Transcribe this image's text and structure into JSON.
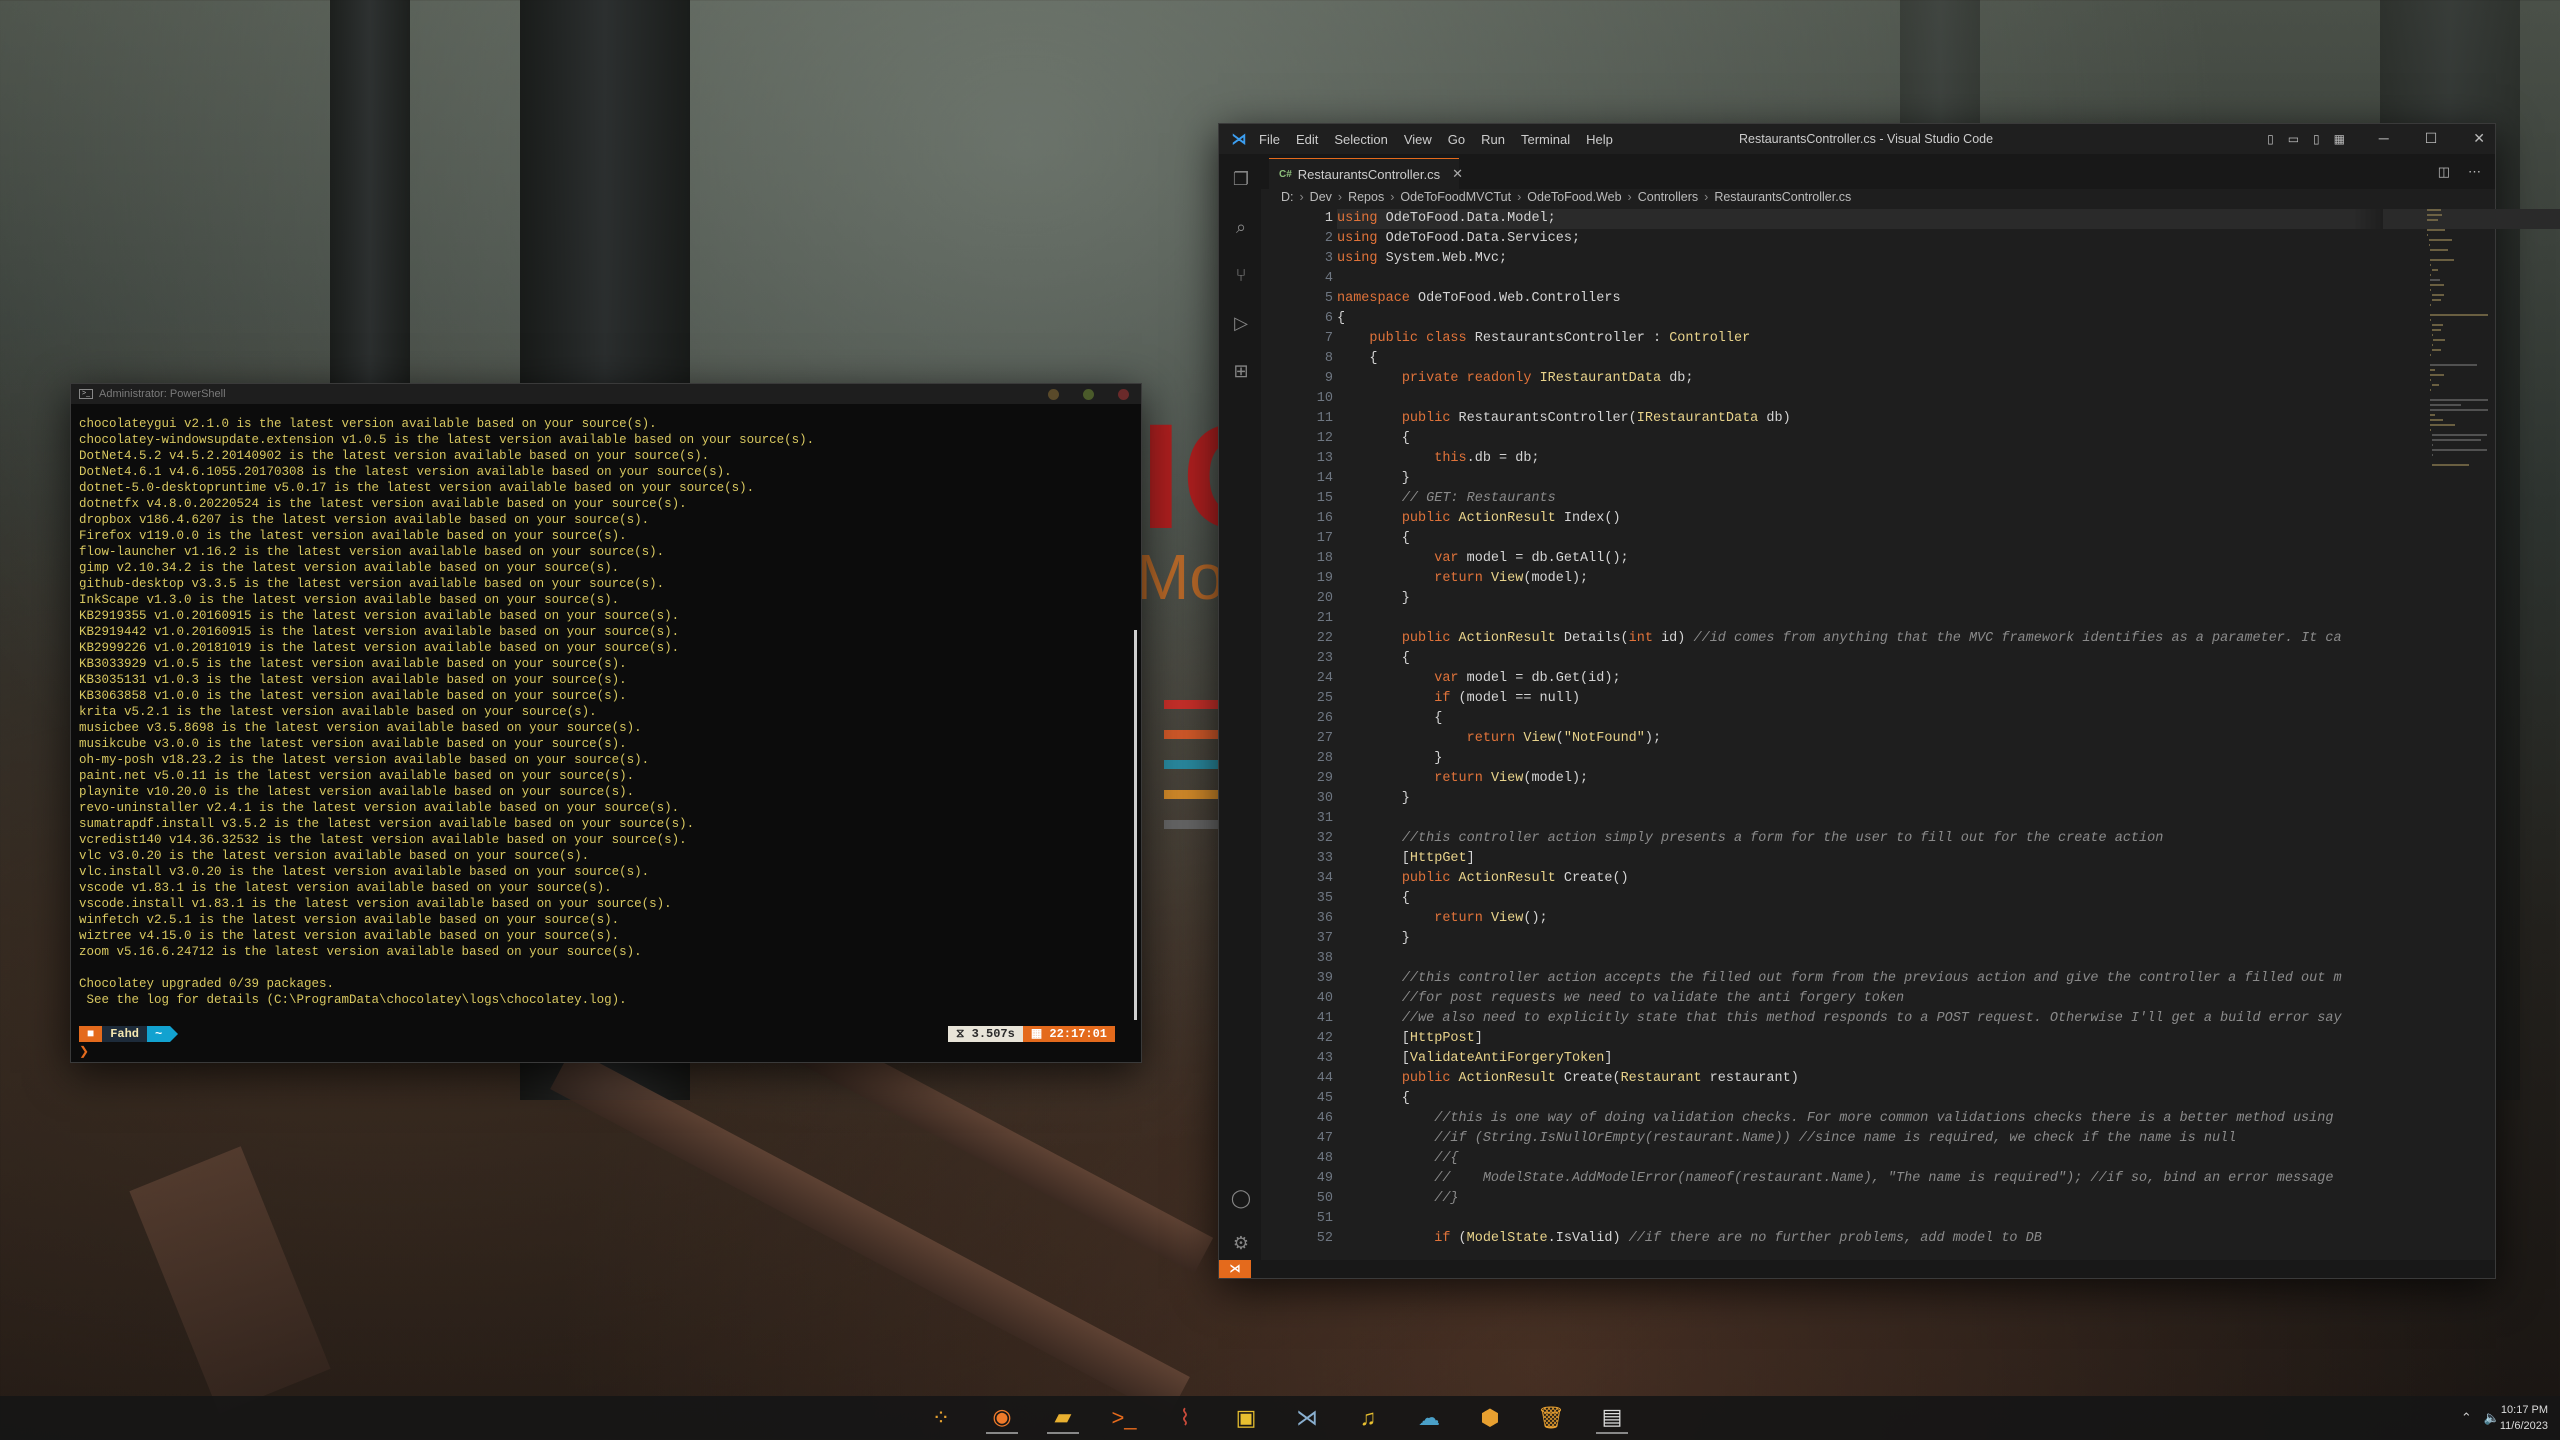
{
  "colors": {
    "accent": "#e46a1c",
    "vscode_blue": "#3c9ef0",
    "terminal_text": "#d8c860"
  },
  "wallpaper": {
    "poster_big": "IC",
    "poster_mon": "Mon"
  },
  "powershell": {
    "title": "Administrator: PowerShell",
    "lines": [
      "chocolateygui v2.1.0 is the latest version available based on your source(s).",
      "chocolatey-windowsupdate.extension v1.0.5 is the latest version available based on your source(s).",
      "DotNet4.5.2 v4.5.2.20140902 is the latest version available based on your source(s).",
      "DotNet4.6.1 v4.6.1055.20170308 is the latest version available based on your source(s).",
      "dotnet-5.0-desktopruntime v5.0.17 is the latest version available based on your source(s).",
      "dotnetfx v4.8.0.20220524 is the latest version available based on your source(s).",
      "dropbox v186.4.6207 is the latest version available based on your source(s).",
      "Firefox v119.0.0 is the latest version available based on your source(s).",
      "flow-launcher v1.16.2 is the latest version available based on your source(s).",
      "gimp v2.10.34.2 is the latest version available based on your source(s).",
      "github-desktop v3.3.5 is the latest version available based on your source(s).",
      "InkScape v1.3.0 is the latest version available based on your source(s).",
      "KB2919355 v1.0.20160915 is the latest version available based on your source(s).",
      "KB2919442 v1.0.20160915 is the latest version available based on your source(s).",
      "KB2999226 v1.0.20181019 is the latest version available based on your source(s).",
      "KB3033929 v1.0.5 is the latest version available based on your source(s).",
      "KB3035131 v1.0.3 is the latest version available based on your source(s).",
      "KB3063858 v1.0.0 is the latest version available based on your source(s).",
      "krita v5.2.1 is the latest version available based on your source(s).",
      "musicbee v3.5.8698 is the latest version available based on your source(s).",
      "musikcube v3.0.0 is the latest version available based on your source(s).",
      "oh-my-posh v18.23.2 is the latest version available based on your source(s).",
      "paint.net v5.0.11 is the latest version available based on your source(s).",
      "playnite v10.20.0 is the latest version available based on your source(s).",
      "revo-uninstaller v2.4.1 is the latest version available based on your source(s).",
      "sumatrapdf.install v3.5.2 is the latest version available based on your source(s).",
      "vcredist140 v14.36.32532 is the latest version available based on your source(s).",
      "vlc v3.0.20 is the latest version available based on your source(s).",
      "vlc.install v3.0.20 is the latest version available based on your source(s).",
      "vscode v1.83.1 is the latest version available based on your source(s).",
      "vscode.install v1.83.1 is the latest version available based on your source(s).",
      "winfetch v2.5.1 is the latest version available based on your source(s).",
      "wiztree v4.15.0 is the latest version available based on your source(s).",
      "zoom v5.16.6.24712 is the latest version available based on your source(s).",
      "",
      "Chocolatey upgraded 0/39 packages.",
      " See the log for details (C:\\ProgramData\\chocolatey\\logs\\chocolatey.log)."
    ],
    "prompt_user": "Fahd",
    "prompt_dir": "~",
    "prompt_duration": "3.507s",
    "prompt_time": "22:17:01",
    "prompt_cursor": "❯"
  },
  "vscode": {
    "window_title": "RestaurantsController.cs - Visual Studio Code",
    "menu": [
      "File",
      "Edit",
      "Selection",
      "View",
      "Go",
      "Run",
      "Terminal",
      "Help"
    ],
    "tab": {
      "lang": "C#",
      "name": "RestaurantsController.cs"
    },
    "breadcrumbs": [
      "D:",
      "Dev",
      "Repos",
      "OdeToFoodMVCTut",
      "OdeToFood.Web",
      "Controllers",
      "RestaurantsController.cs"
    ],
    "code_lines": [
      "using OdeToFood.Data.Model;",
      "using OdeToFood.Data.Services;",
      "using System.Web.Mvc;",
      "",
      "namespace OdeToFood.Web.Controllers",
      "{",
      "    public class RestaurantsController : Controller",
      "    {",
      "        private readonly IRestaurantData db;",
      "",
      "        public RestaurantsController(IRestaurantData db)",
      "        {",
      "            this.db = db;",
      "        }",
      "        // GET: Restaurants",
      "        public ActionResult Index()",
      "        {",
      "            var model = db.GetAll();",
      "            return View(model);",
      "        }",
      "",
      "        public ActionResult Details(int id) //id comes from anything that the MVC framework identifies as a parameter. It ca",
      "        {",
      "            var model = db.Get(id);",
      "            if (model == null)",
      "            {",
      "                return View(\"NotFound\");",
      "            }",
      "            return View(model);",
      "        }",
      "",
      "        //this controller action simply presents a form for the user to fill out for the create action",
      "        [HttpGet]",
      "        public ActionResult Create()",
      "        {",
      "            return View();",
      "        }",
      "",
      "        //this controller action accepts the filled out form from the previous action and give the controller a filled out m",
      "        //for post requests we need to validate the anti forgery token",
      "        //we also need to explicitly state that this method responds to a POST request. Otherwise I'll get a build error say",
      "        [HttpPost]",
      "        [ValidateAntiForgeryToken]",
      "        public ActionResult Create(Restaurant restaurant)",
      "        {",
      "            //this is one way of doing validation checks. For more common validations checks there is a better method using",
      "            //if (String.IsNullOrEmpty(restaurant.Name)) //since name is required, we check if the name is null",
      "            //{",
      "            //    ModelState.AddModelError(nameof(restaurant.Name), \"The name is required\"); //if so, bind an error message",
      "            //}",
      "",
      "            if (ModelState.IsValid) //if there are no further problems, add model to DB"
    ]
  },
  "taskbar": {
    "time": "10:17 PM",
    "date": "11/6/2023",
    "apps": [
      "start",
      "firefox",
      "files",
      "terminal",
      "github",
      "game",
      "vscode",
      "music",
      "cloud",
      "package",
      "trash",
      "powershell"
    ]
  }
}
